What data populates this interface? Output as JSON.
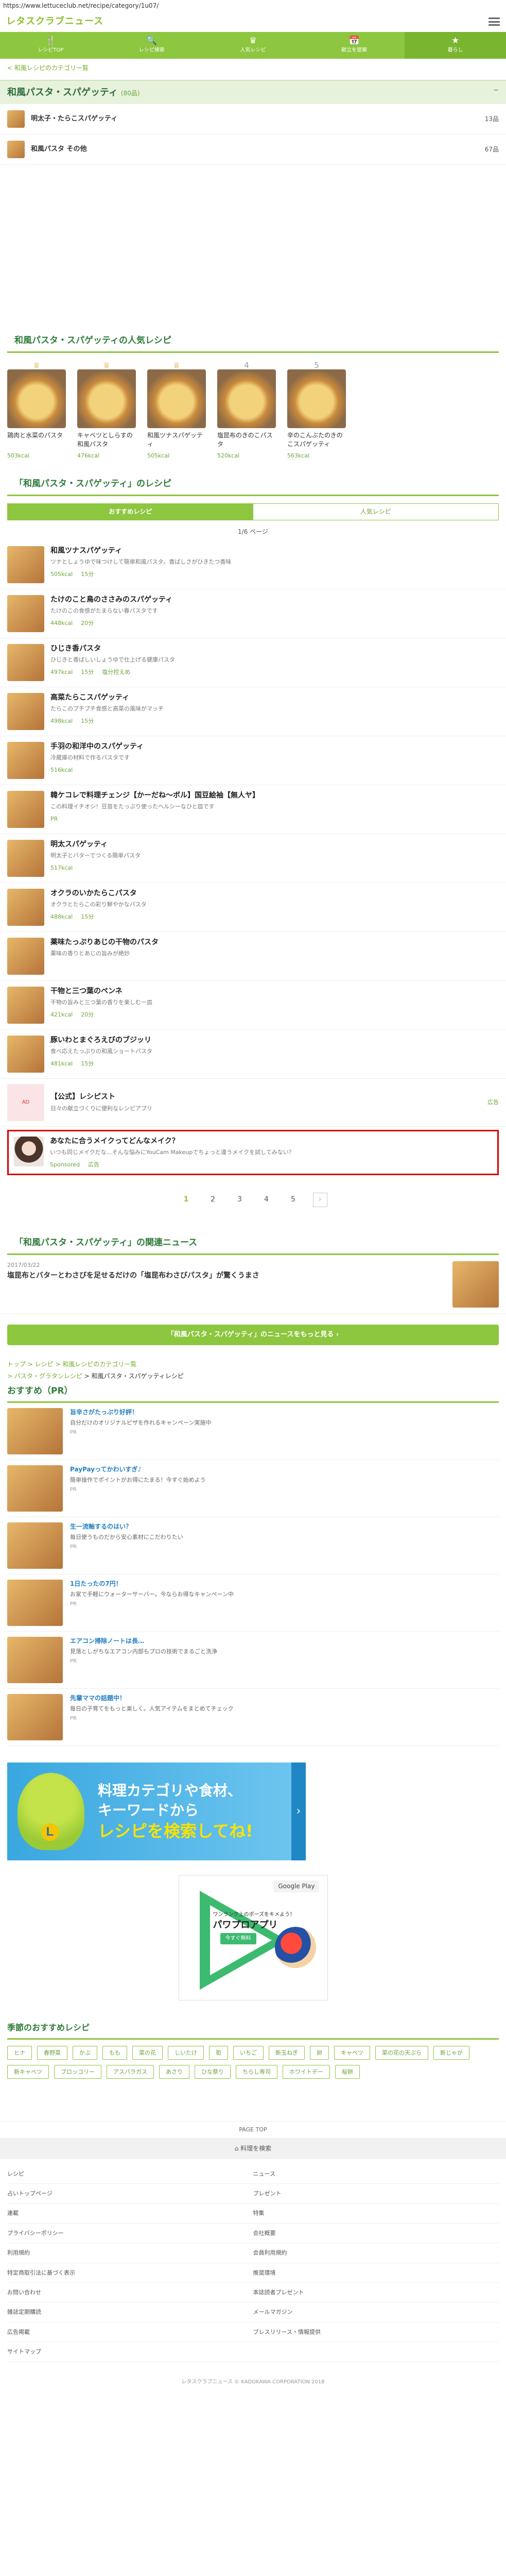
{
  "browser": {
    "url": "https://www.lettuceclub.net/recipe/category/1u07/"
  },
  "site": {
    "logo": "レタスクラブニュース"
  },
  "nav": [
    {
      "icon": "🍴",
      "label": "レシピTOP"
    },
    {
      "icon": "🔍",
      "label": "レシピ検索"
    },
    {
      "icon": "♛",
      "label": "人気レシピ"
    },
    {
      "icon": "📅",
      "label": "献立を提案"
    },
    {
      "icon": "★",
      "label": "暮らし"
    }
  ],
  "breadcrumb_top": "< 和風レシピのカテゴリー覧",
  "category": {
    "title": "和風パスタ・スパゲッティ",
    "sub": "(80品)",
    "toggle": "−"
  },
  "subcategories": [
    {
      "name": "明太子・たらこスパゲッティ",
      "count": "13品"
    },
    {
      "name": "和風パスタ その他",
      "count": "67品"
    }
  ],
  "popular": {
    "title": "和風パスタ・スパゲッティの人気レシピ",
    "items": [
      {
        "rank": "♕",
        "name": "鶏肉と水菜のパスタ",
        "kcal": "503kcal"
      },
      {
        "rank": "♕",
        "name": "キャベツとしらすの和風パスタ",
        "kcal": "476kcal"
      },
      {
        "rank": "♕",
        "name": "和風ツナスパゲッティ",
        "kcal": "505kcal"
      },
      {
        "rank": "4",
        "name": "塩昆布のきのこパスタ",
        "kcal": "520kcal"
      },
      {
        "rank": "5",
        "name": "辛のこんぶたのきのこスパゲッティ",
        "kcal": "563kcal"
      }
    ]
  },
  "recipes_section": {
    "title": "「和風パスタ・スパゲッティ」のレシピ",
    "tab_new": "おすすめレシピ",
    "tab_popular": "人気レシピ",
    "page_info": "1/6 ページ"
  },
  "recipes": [
    {
      "title": "和風ツナスパゲッティ",
      "desc": "ツナとしょうゆで味つけして簡単和風パスタ。香ばしさがひきたつ香味",
      "kcal": "505kcal",
      "time": "15分",
      "extra": ""
    },
    {
      "title": "たけのこと鳥のささみのスパゲッティ",
      "desc": "たけのこの食感がたまらない春パスタです",
      "kcal": "448kcal",
      "time": "20分",
      "extra": ""
    },
    {
      "title": "ひじき香パスタ",
      "desc": "ひじきと香ばしいしょうゆで仕上げる健康パスタ",
      "kcal": "497kcal",
      "time": "15分",
      "extra": "塩分控えめ"
    },
    {
      "title": "高菜たらこスパゲッティ",
      "desc": "たらこのプチプチ食感と高菜の風味がマッチ",
      "kcal": "498kcal",
      "time": "15分",
      "extra": ""
    },
    {
      "title": "手羽の和洋中のスパゲッティ",
      "desc": "冷蔵庫の材料で作るパスタです",
      "kcal": "516kcal",
      "time": "",
      "extra": ""
    },
    {
      "title": "韓ケコレで料理チェンジ【かーだね〜ボル】国豆絵袖【無人ヤ】",
      "desc": "この料理イチオシ！豆苗をたっぷり使ったヘルシーなひと皿です",
      "kcal": "",
      "time": "",
      "extra": "PR"
    },
    {
      "title": "明太スパゲッティ",
      "desc": "明太子とバターでつくる簡単パスタ",
      "kcal": "517kcal",
      "time": "",
      "extra": ""
    },
    {
      "title": "オクラのいかたらこパスタ",
      "desc": "オクラとたらこの彩り鮮やかなパスタ",
      "kcal": "488kcal",
      "time": "15分",
      "extra": ""
    },
    {
      "title": "薬味たっぷりあじの干物のパスタ",
      "desc": "薬味の香りとあじの旨みが絶妙",
      "kcal": "",
      "time": "",
      "extra": ""
    },
    {
      "title": "干物と三つ葉のペンネ",
      "desc": "干物の旨みと三つ葉の香りを楽しむ一皿",
      "kcal": "421kcal",
      "time": "20分",
      "extra": ""
    },
    {
      "title": "豚いわとまぐろえびのブジッリ",
      "desc": "食べ応えたっぷりの和風ショートパスタ",
      "kcal": "481kcal",
      "time": "15分",
      "extra": ""
    }
  ],
  "ad": {
    "title": "【公式】レシピスト",
    "desc": "日々の献立づくりに便利なレシピアプリ",
    "label": "広告",
    "img_text": "AD"
  },
  "highlight": {
    "title": "あなたに合うメイクってどんなメイク？",
    "desc": "いつも同じメイクだな…そんな悩みにYouCam Makeupでちょっと違うメイクを試してみない？",
    "brand": "Sponsored",
    "label": "広告"
  },
  "pager": [
    "1",
    "2",
    "3",
    "4",
    "5",
    "›"
  ],
  "news": {
    "title": "「和風パスタ・スパゲッティ」の関連ニュース",
    "date": "2017/03/22",
    "headline": "塩昆布とバターとわさびを足せるだけの「塩昆布わさびパスタ」が驚くうまさ",
    "more_button": "「和風パスタ・スパゲッティ」のニュースをもっと見る ›"
  },
  "crumbs": {
    "line1": "トップ > レシピ > 和風レシピのカテゴリー覧",
    "line2_link": "> パスタ・グラタンレシピ",
    "line2_current": "> 和風パスタ・スパゲッティレシピ"
  },
  "osusume": {
    "title": "おすすめ（PR）",
    "items": [
      {
        "title": "旨辛さがたっぷり好評！",
        "desc": "自分だけのオリジナルピザを作れるキャンペーン実施中",
        "pr": "PR"
      },
      {
        "title": "PayPayってかわいすぎ♪",
        "desc": "簡単操作でポイントがお得にたまる！今すぐ始めよう",
        "pr": "PR"
      },
      {
        "title": "生一流軸するのはい？",
        "desc": "毎日使うものだから安心素材にこだわりたい",
        "pr": "PR"
      },
      {
        "title": "1日たったの7円！",
        "desc": "お家で手軽にウォーターサーバー。今ならお得なキャンペーン中",
        "pr": "PR"
      },
      {
        "title": "エアコン掃除ノートは長…",
        "desc": "見落としがちなエアコン内部もプロの技術でまるごと洗浄",
        "pr": "PR"
      },
      {
        "title": "先輩ママの話題中！",
        "desc": "毎日の子育てをもっと楽しく。人気アイテムをまとめてチェック",
        "pr": "PR"
      }
    ]
  },
  "banner": {
    "line1": "料理カテゴリや食材、",
    "line2": "キーワードから",
    "line3": "レシピを検索してね!",
    "arrow": "›"
  },
  "app_ad": {
    "store": "Google Play",
    "sub": "ワンランク上のポーズをキメよう！",
    "title": "パワプロアプリ",
    "download": "今すぐ無料"
  },
  "keywords": {
    "title": "季節のおすすめレシピ",
    "items": [
      "ヒナ",
      "春野菜",
      "かぶ",
      "もも",
      "菜の花",
      "しいたけ",
      "筍",
      "いちご",
      "新玉ねぎ",
      "卵",
      "キャベツ",
      "菜の花の天ぷら",
      "新じゃが",
      "新キャベツ",
      "ブロッコリー",
      "アスパラガス",
      "あさり",
      "ひな祭り",
      "ちらし寿司",
      "ホワイトデー",
      "桜餅"
    ]
  },
  "footer": {
    "page_top": "PAGE TOP",
    "home": "⌂ 料理を検索",
    "links": [
      "レシピ",
      "ニュース",
      "占いトップページ",
      "プレゼント",
      "連載",
      "特集",
      "プライバシーポリシー",
      "会社概要",
      "利用規約",
      "会員利用規約",
      "特定商取引法に基づく表示",
      "推奨環境",
      "お問い合わせ",
      "本誌読者プレゼント",
      "雑誌定期購読",
      "メールマガジン",
      "広告掲載",
      "プレスリリース・情報提供",
      "サイトマップ",
      ""
    ],
    "copyright": "レタスクラブニュース © KADOKAWA CORPORATION 2018"
  }
}
